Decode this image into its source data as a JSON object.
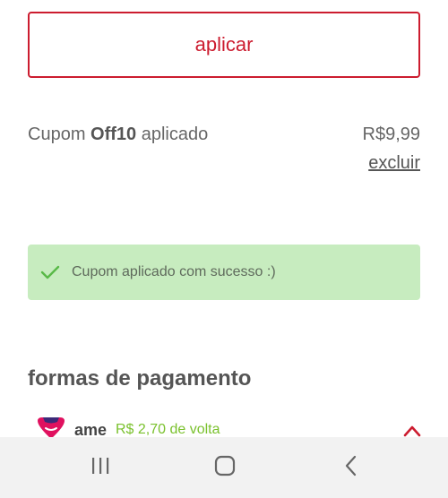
{
  "apply_button": {
    "label": "aplicar"
  },
  "coupon": {
    "prefix": "Cupom ",
    "code": "Off10",
    "suffix": " aplicado",
    "value": "R$9,99",
    "remove_label": "excluir"
  },
  "success_banner": {
    "message": "Cupom aplicado com sucesso :)",
    "icon": "check-icon"
  },
  "payment_section": {
    "title": "formas de pagamento",
    "methods": [
      {
        "name": "ame",
        "cashback": "R$ 2,70 de volta",
        "icon": "ame-logo",
        "expand_icon": "chevron-up-icon"
      }
    ]
  },
  "system_nav": {
    "buttons": [
      "recent-apps-icon",
      "home-icon",
      "back-icon"
    ]
  },
  "colors": {
    "brand_red": "#cc1c2f",
    "success_bg": "#c7ecbf",
    "success_check": "#58b947",
    "cashback_green": "#7ac12d",
    "ame_pink": "#e0115f"
  }
}
